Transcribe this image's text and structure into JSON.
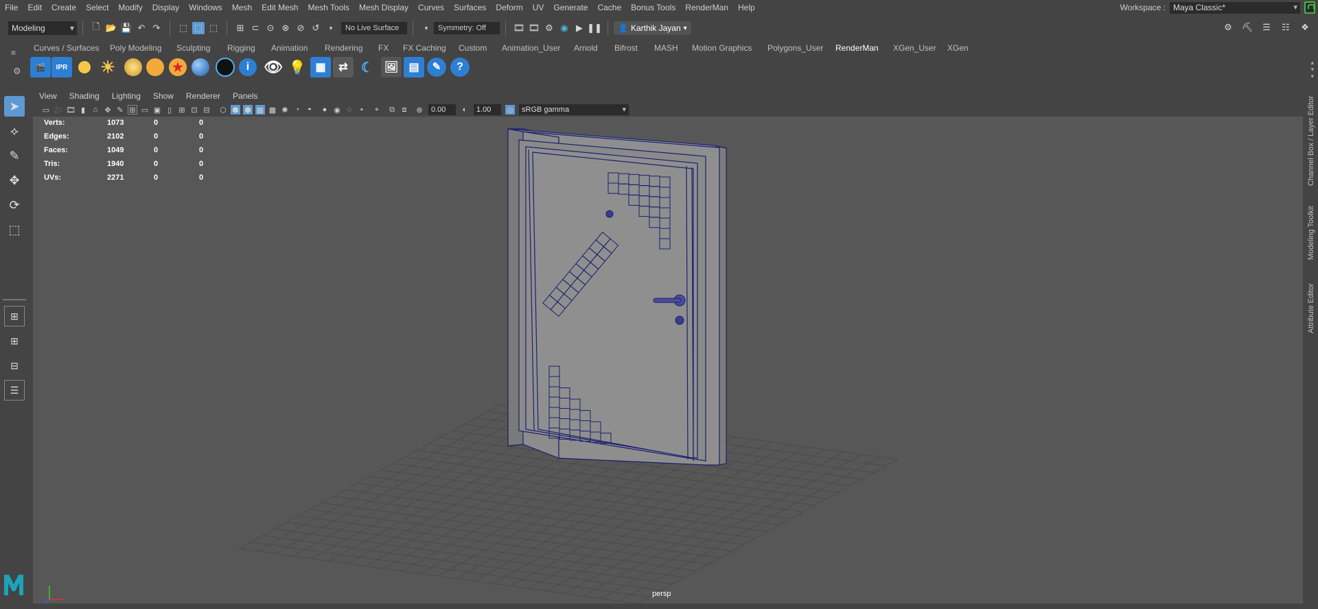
{
  "menubar": {
    "items": [
      "File",
      "Edit",
      "Create",
      "Select",
      "Modify",
      "Display",
      "Windows",
      "Mesh",
      "Edit Mesh",
      "Mesh Tools",
      "Mesh Display",
      "Curves",
      "Surfaces",
      "Deform",
      "UV",
      "Generate",
      "Cache",
      "Bonus Tools",
      "RenderMan",
      "Help"
    ],
    "workspace_label": "Workspace :",
    "workspace_value": "Maya Classic*"
  },
  "statusline": {
    "mode": "Modeling",
    "live_surface": "No Live Surface",
    "symmetry": "Symmetry: Off",
    "user": "Karthik Jayan"
  },
  "shelf": {
    "tabs": [
      "Curves / Surfaces",
      "Poly Modeling",
      "Sculpting",
      "Rigging",
      "Animation",
      "Rendering",
      "FX",
      "FX Caching",
      "Custom",
      "Animation_User",
      "Arnold",
      "Bifrost",
      "MASH",
      "Motion Graphics",
      "Polygons_User",
      "RenderMan",
      "XGen_User",
      "XGen"
    ],
    "active_tab": "RenderMan",
    "ipr_label": "IPR"
  },
  "panel": {
    "menus": [
      "View",
      "Shading",
      "Lighting",
      "Show",
      "Renderer",
      "Panels"
    ],
    "exposure": "0.00",
    "gamma": "1.00",
    "color_space": "sRGB gamma"
  },
  "hud": {
    "rows": [
      {
        "label": "Verts:",
        "a": "1073",
        "b": "0",
        "c": "0"
      },
      {
        "label": "Edges:",
        "a": "2102",
        "b": "0",
        "c": "0"
      },
      {
        "label": "Faces:",
        "a": "1049",
        "b": "0",
        "c": "0"
      },
      {
        "label": "Tris:",
        "a": "1940",
        "b": "0",
        "c": "0"
      },
      {
        "label": "UVs:",
        "a": "2271",
        "b": "0",
        "c": "0"
      }
    ]
  },
  "viewport": {
    "camera": "persp",
    "wire_color": "#1c1f6e",
    "surface_color": "#8f8f8f"
  },
  "sidetabs": [
    "Channel Box / Layer Editor",
    "Modeling Toolkit",
    "Attribute Editor"
  ],
  "colors": {
    "accent": "#5d9ad3",
    "lock": "#3dbb3d"
  }
}
